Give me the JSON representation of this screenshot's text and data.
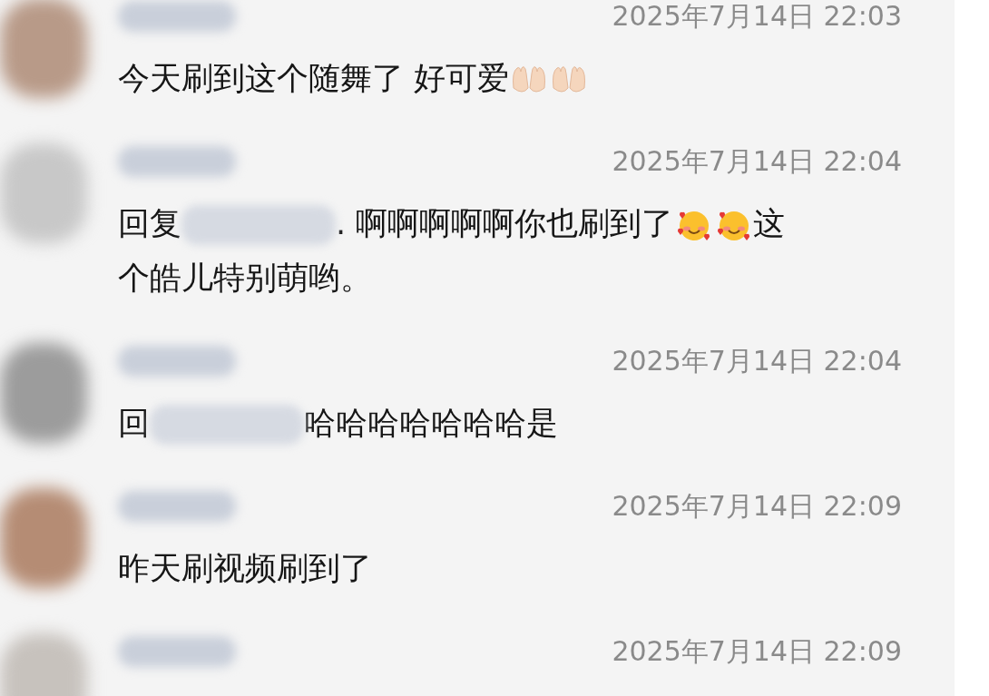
{
  "comments": [
    {
      "timestamp": "2025年7月14日 22:03",
      "content": [
        {
          "kind": "text",
          "text": "今天刷到这个随舞了 好可爱"
        },
        {
          "kind": "palms-emoji"
        },
        {
          "kind": "palms-emoji"
        }
      ]
    },
    {
      "timestamp": "2025年7月14日 22:04",
      "content": [
        {
          "kind": "text",
          "text": "回复"
        },
        {
          "kind": "hidden"
        },
        {
          "kind": "text",
          "text": ". 啊啊啊啊啊你也刷到了"
        },
        {
          "kind": "hearts-face-emoji"
        },
        {
          "kind": "hearts-face-emoji"
        },
        {
          "kind": "text",
          "text": "这"
        },
        {
          "kind": "text",
          "text": "个皓儿特别萌哟。"
        }
      ]
    },
    {
      "timestamp": "2025年7月14日 22:04",
      "content": [
        {
          "kind": "text",
          "text": "回"
        },
        {
          "kind": "hidden"
        },
        {
          "kind": "text",
          "text": "哈哈哈哈哈哈哈是"
        }
      ]
    },
    {
      "timestamp": "2025年7月14日 22:09",
      "content": [
        {
          "kind": "text",
          "text": "昨天刷视频刷到了"
        }
      ]
    },
    {
      "timestamp": "2025年7月14日 22:09"
    }
  ]
}
